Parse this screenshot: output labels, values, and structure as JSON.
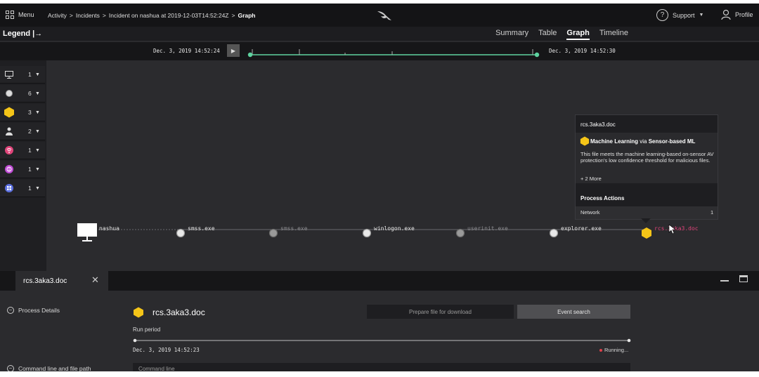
{
  "topbar": {
    "menu_label": "Menu",
    "breadcrumb": [
      "Activity",
      "Incidents",
      "Incident on nashua at 2019-12-03T14:52:24Z",
      "Graph"
    ],
    "separator": ">",
    "support_label": "Support",
    "profile_label": "Profile"
  },
  "legend": {
    "header": "Legend |→",
    "items": [
      {
        "icon": "monitor-icon",
        "count": "1"
      },
      {
        "icon": "circle-icon",
        "count": "6"
      },
      {
        "icon": "hexagon-icon",
        "count": "3",
        "color": "#f5c518"
      },
      {
        "icon": "user-icon",
        "count": "2"
      },
      {
        "icon": "network-icon",
        "count": "1",
        "color": "#e0447a"
      },
      {
        "icon": "dns-icon",
        "count": "1",
        "color": "#c04bd6"
      },
      {
        "icon": "app-icon",
        "count": "1",
        "color": "#5b6fe0"
      }
    ]
  },
  "tabs": [
    {
      "label": "Summary",
      "active": false
    },
    {
      "label": "Table",
      "active": false
    },
    {
      "label": "Graph",
      "active": true
    },
    {
      "label": "Timeline",
      "active": false
    }
  ],
  "timeline": {
    "start": "Dec. 3, 2019 14:52:24",
    "end": "Dec. 3, 2019 14:52:30",
    "accent": "#5ed3a0"
  },
  "graph": {
    "nodes": [
      {
        "label": "nashua",
        "kind": "host",
        "dimmed": false
      },
      {
        "label": "smss.exe",
        "kind": "process",
        "dimmed": false
      },
      {
        "label": "smss.exe",
        "kind": "process",
        "dimmed": true
      },
      {
        "label": "winlogon.exe",
        "kind": "process",
        "dimmed": false
      },
      {
        "label": "userinit.exe",
        "kind": "process",
        "dimmed": true
      },
      {
        "label": "explorer.exe",
        "kind": "process",
        "dimmed": false
      },
      {
        "label": "rcs.3aka3.doc",
        "kind": "detection",
        "dimmed": false,
        "color": "#e0447a"
      }
    ]
  },
  "tooltip": {
    "title": "rcs.3aka3.doc",
    "tactic": "Machine Learning",
    "via": "via",
    "technique": "Sensor-based ML",
    "description": "This file meets the machine learning-based on-sensor AV protection's low confidence threshold for malicious files.",
    "more": "+ 2 More",
    "actions_title": "Process Actions",
    "network_label": "Network",
    "network_count": "1"
  },
  "panel": {
    "tab_label": "rcs.3aka3.doc",
    "process_details_label": "Process Details",
    "cmdline_section_label": "Command line and file path",
    "process_name": "rcs.3aka3.doc",
    "prepare_label": "Prepare file for download",
    "event_search_label": "Event search",
    "run_period_label": "Run period",
    "run_start": "Dec. 3, 2019 14:52:23",
    "run_status": "Running...",
    "cmdline_placeholder": "Command line"
  }
}
